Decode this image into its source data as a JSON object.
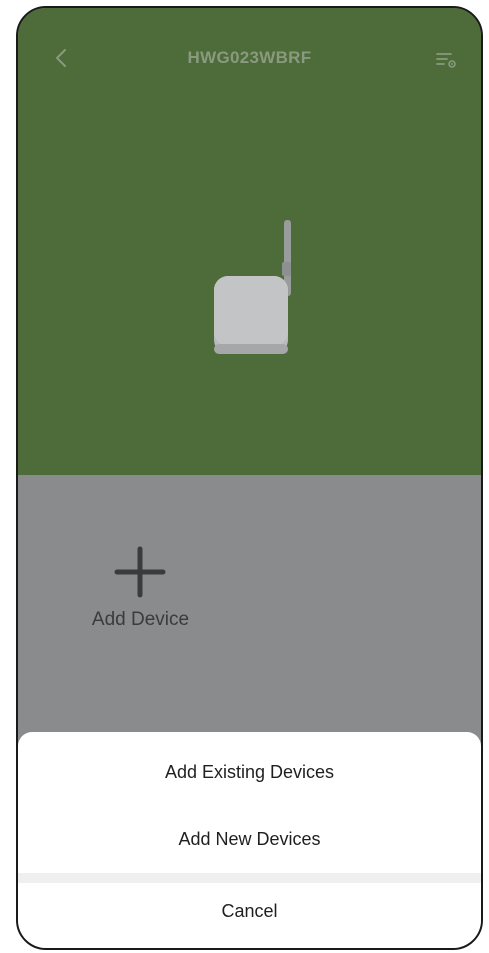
{
  "header": {
    "title": "HWG023WBRF",
    "back_icon": "chevron-left-icon",
    "settings_icon": "settings-list-icon"
  },
  "colors": {
    "hero_bg": "#4e6b3a",
    "overlay_bg": "#8a8b8d",
    "sheet_bg": "#ffffff"
  },
  "device": {
    "image": "wifi-gateway-image"
  },
  "add_device": {
    "icon": "plus-icon",
    "label": "Add Device"
  },
  "action_sheet": {
    "options": [
      "Add Existing Devices",
      "Add New Devices"
    ],
    "cancel": "Cancel"
  }
}
